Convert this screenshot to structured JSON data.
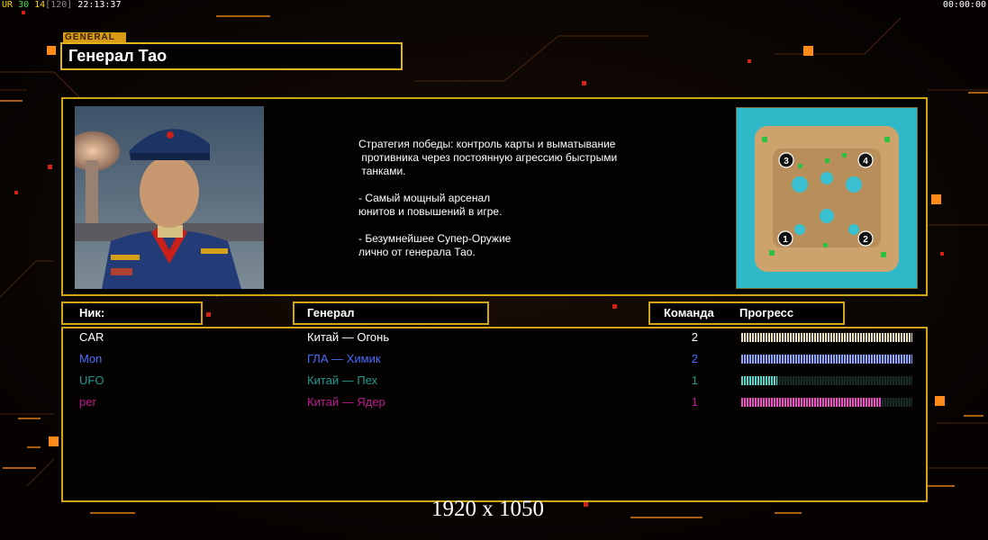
{
  "status": {
    "parts": [
      {
        "text": "UR",
        "color": "#f5d400"
      },
      {
        "text": " 30",
        "color": "#3ee03e"
      },
      {
        "text": " 14",
        "color": "#f5d400"
      },
      {
        "text": "[120]",
        "color": "#8a8a8a"
      },
      {
        "text": " 22:13:37",
        "color": "#ffffff"
      }
    ],
    "timer": "00:00:00"
  },
  "general_tab": "GENERAL",
  "title": "Генерал Тао",
  "description": "Стратегия победы: контроль карты и выматывание\n противника через постоянную агрессию быстрыми\n танками.\n\n- Самый мощный арсенал\nюнитов и повышений в игре.\n\n- Безумнейшее Супер-Оружие\nлично от генерала Тао.",
  "map_markers": [
    "3",
    "4",
    "1",
    "2"
  ],
  "headers": {
    "nick": "Ник:",
    "general": "Генерал",
    "team": "Команда",
    "progress": "Прогресс"
  },
  "players": [
    {
      "nick": "CAR",
      "general": "Китай — Огонь",
      "team": "2",
      "progress": 1.0,
      "color": "#ffffff",
      "bar_color": "#f2e6bc"
    },
    {
      "nick": "Mon",
      "general": "ГЛА — Химик",
      "team": "2",
      "progress": 1.0,
      "color": "#4a6dff",
      "bar_color": "#8ea4ff"
    },
    {
      "nick": "UFO",
      "general": "Китай — Пех",
      "team": "1",
      "progress": 0.21,
      "color": "#1e9c94",
      "bar_color": "#56d8cc"
    },
    {
      "nick": "per",
      "general": "Китай — Ядер",
      "team": "1",
      "progress": 0.82,
      "color": "#c01890",
      "bar_color": "#f050c8"
    }
  ],
  "resolution": "1920 x 1050"
}
